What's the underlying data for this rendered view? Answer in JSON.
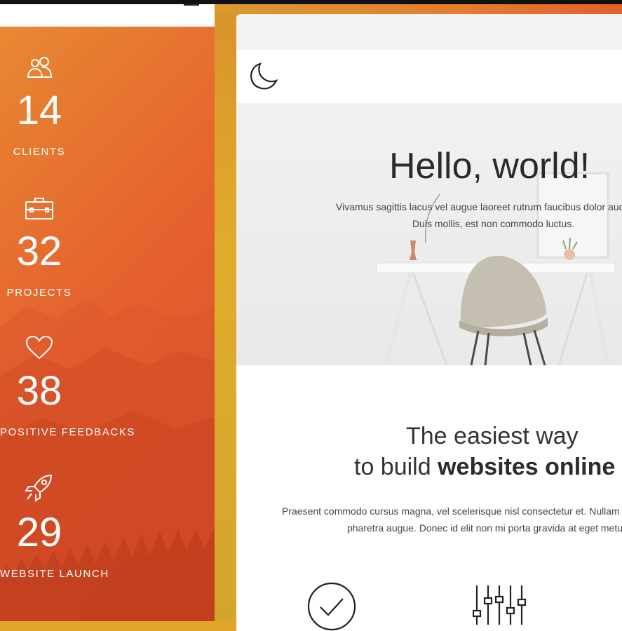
{
  "stats": [
    {
      "icon": "users-icon",
      "value": "14",
      "label": "CLIENTS"
    },
    {
      "icon": "briefcase-icon",
      "value": "32",
      "label": "PROJECTS"
    },
    {
      "icon": "heart-icon",
      "value": "38",
      "label": "POSITIVE FEEDBACKS"
    },
    {
      "icon": "rocket-icon",
      "value": "29",
      "label": "WEBSITE LAUNCH"
    }
  ],
  "hero": {
    "title": "Hello, world!",
    "subtitle_line1": "Vivamus sagittis lacus vel augue laoreet rutrum faucibus dolor auctor.",
    "subtitle_line2": "Duis mollis, est non commodo luctus."
  },
  "section": {
    "heading_line1": "The easiest way",
    "heading_line2_prefix": "to build ",
    "heading_line2_bold": "websites online",
    "paragraph_line1": "Praesent commodo cursus magna, vel scelerisque nisl consectetur et. Nullam quis risus eget urna",
    "paragraph_line2": "pharetra augue. Donec id elit non mi porta gravida at eget metus."
  },
  "feature_icons": [
    "check-circle-icon",
    "sliders-icon"
  ],
  "colors": {
    "panel_gradient_start": "#e88b33",
    "panel_gradient_end": "#e2452a",
    "frame": "#e0ac2c",
    "text_dark": "#2a2a2a"
  }
}
